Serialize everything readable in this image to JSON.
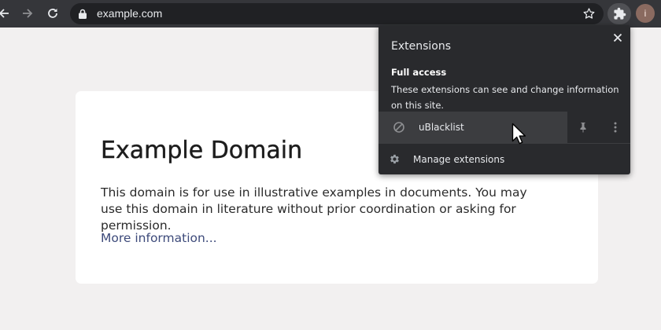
{
  "toolbar": {
    "url": "example.com",
    "icons": {
      "back": "arrow-left-icon",
      "forward": "arrow-right-icon",
      "reload": "reload-icon",
      "lock": "lock-icon",
      "bookmark": "star-icon",
      "extensions": "puzzle-icon"
    },
    "profile_initial": "i"
  },
  "page": {
    "heading": "Example Domain",
    "description": "This domain is for use in illustrative examples in documents. You may use this domain in literature without prior coordination or asking for permission.",
    "more_link": "More information..."
  },
  "extensions_popup": {
    "title": "Extensions",
    "section_heading": "Full access",
    "section_description": "These extensions can see and change information on this site.",
    "extensions": [
      {
        "name": "uBlacklist",
        "icon": "blocked-icon"
      }
    ],
    "manage_label": "Manage extensions"
  },
  "colors": {
    "toolbar_bg": "#35363a",
    "omnibox_bg": "#202124",
    "popup_bg": "#292a2d",
    "popup_row_highlight": "#3c3d40",
    "page_bg": "#f2f0f0",
    "link": "#3d4a7a"
  }
}
